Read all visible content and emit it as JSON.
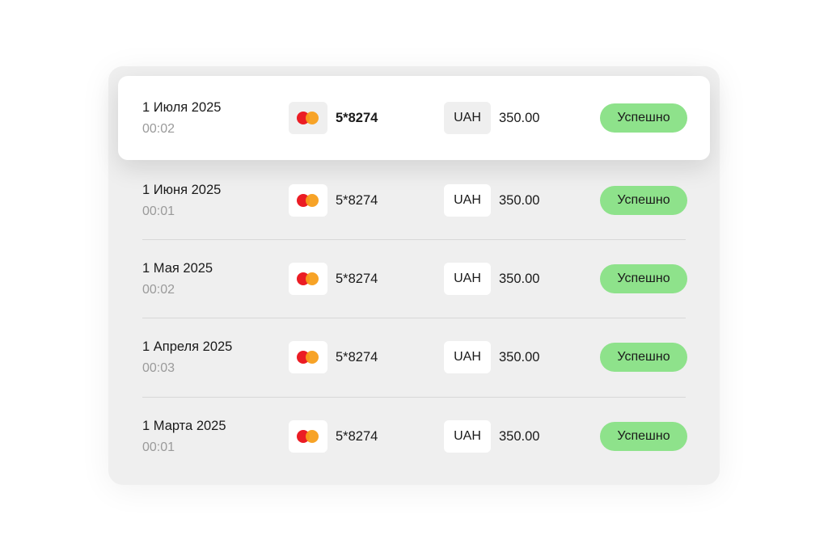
{
  "transactions": [
    {
      "date": "1 Июля 2025",
      "time": "00:02",
      "card_icon": "mastercard-icon",
      "card": "5*8274",
      "currency": "UAH",
      "amount": "350.00",
      "status": "Успешно"
    },
    {
      "date": "1 Июня 2025",
      "time": "00:01",
      "card_icon": "mastercard-icon",
      "card": "5*8274",
      "currency": "UAH",
      "amount": "350.00",
      "status": "Успешно"
    },
    {
      "date": "1 Мая 2025",
      "time": "00:02",
      "card_icon": "mastercard-icon",
      "card": "5*8274",
      "currency": "UAH",
      "amount": "350.00",
      "status": "Успешно"
    },
    {
      "date": "1 Апреля 2025",
      "time": "00:03",
      "card_icon": "mastercard-icon",
      "card": "5*8274",
      "currency": "UAH",
      "amount": "350.00",
      "status": "Успешно"
    },
    {
      "date": "1 Марта 2025",
      "time": "00:01",
      "card_icon": "mastercard-icon",
      "card": "5*8274",
      "currency": "UAH",
      "amount": "350.00",
      "status": "Успешно"
    }
  ],
  "colors": {
    "status_success": "#8ee28b",
    "mastercard_red": "#eb1c24",
    "mastercard_orange": "#f79e1b"
  }
}
